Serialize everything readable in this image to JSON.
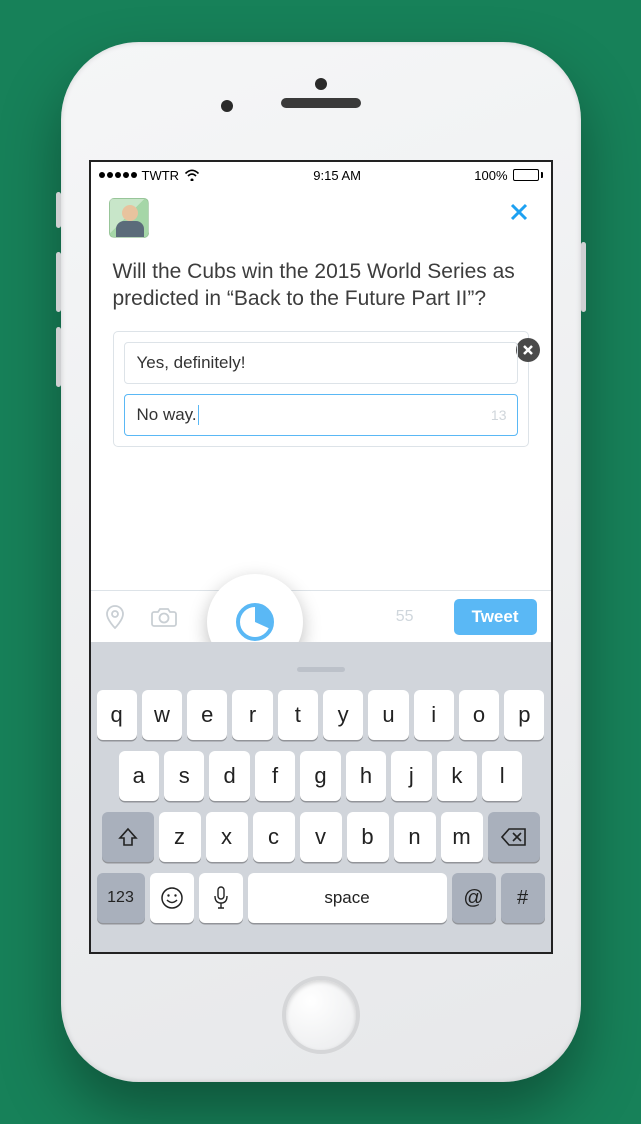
{
  "status_bar": {
    "carrier": "TWTR",
    "time": "9:15 AM",
    "battery_pct": "100%"
  },
  "compose": {
    "tweet_text": "Will the Cubs win the 2015 World Series as predicted in “Back to the Future Part II”?",
    "char_remaining": "55",
    "tweet_button": "Tweet",
    "poll": {
      "options": [
        {
          "text": "Yes, definitely!",
          "remaining": ""
        },
        {
          "text": "No way.",
          "remaining": "13"
        }
      ]
    }
  },
  "keyboard": {
    "row1": [
      "q",
      "w",
      "e",
      "r",
      "t",
      "y",
      "u",
      "i",
      "o",
      "p"
    ],
    "row2": [
      "a",
      "s",
      "d",
      "f",
      "g",
      "h",
      "j",
      "k",
      "l"
    ],
    "row3": [
      "z",
      "x",
      "c",
      "v",
      "b",
      "n",
      "m"
    ],
    "num_key": "123",
    "space": "space",
    "at_key": "@",
    "hash_key": "#"
  }
}
